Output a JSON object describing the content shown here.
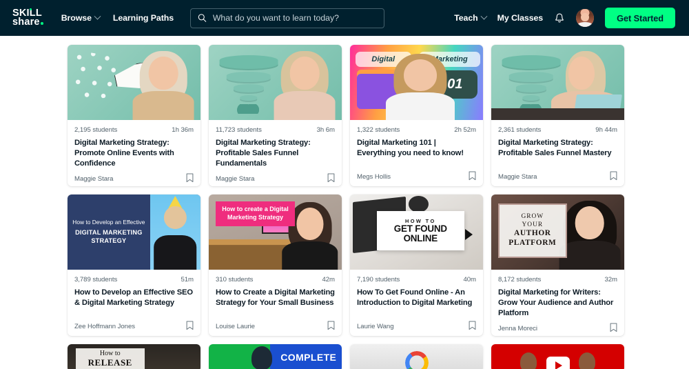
{
  "header": {
    "logo": {
      "line1": "SKILL",
      "line2": "share",
      "dot": "."
    },
    "nav": [
      {
        "label": "Browse",
        "has_chevron": true
      },
      {
        "label": "Learning Paths",
        "has_chevron": false
      }
    ],
    "search": {
      "placeholder": "What do you want to learn today?",
      "value": "",
      "icon": "search-icon"
    },
    "nav_right": [
      {
        "label": "Teach",
        "has_chevron": true
      },
      {
        "label": "My Classes",
        "has_chevron": false
      }
    ],
    "bell_icon": "bell-icon",
    "avatar": "user-avatar",
    "cta": {
      "label": "Get Started",
      "color": "#00FF84"
    }
  },
  "colors": {
    "header_bg": "#00202E",
    "accent_green": "#00FF84",
    "text_dark": "#002333",
    "meta_gray": "#52616B",
    "page_bg": "#FFFFFF"
  },
  "cards": [
    {
      "students": "2,195 students",
      "duration": "1h 36m",
      "title": "Digital Marketing Strategy: Promote Online Events with Confidence",
      "author": "Maggie Stara",
      "thumb": "megaphone-marketing-mint",
      "bookmark_icon": "bookmark-icon"
    },
    {
      "students": "11,723 students",
      "duration": "3h 6m",
      "title": "Digital Marketing Strategy: Profitable Sales Funnel Fundamentals",
      "author": "Maggie Stara",
      "thumb": "sales-funnel-mint",
      "bookmark_icon": "bookmark-icon"
    },
    {
      "students": "1,322 students",
      "duration": "2h 52m",
      "title": "Digital Marketing 101 | Everything you need to know!",
      "author": "Megs Hollis",
      "thumb": "digital-marketing-101-gradient",
      "thumb_text": {
        "left": "Digital",
        "right": "Marketing",
        "badge": "101"
      },
      "bookmark_icon": "bookmark-icon"
    },
    {
      "students": "2,361 students",
      "duration": "9h 44m",
      "title": "Digital Marketing Strategy: Profitable Sales Funnel Mastery",
      "author": "Maggie Stara",
      "thumb": "sales-funnel-laptop-mint",
      "bookmark_icon": "bookmark-icon"
    },
    {
      "students": "3,789 students",
      "duration": "51m",
      "title": "How to Develop an Effective SEO & Digital Marketing Strategy",
      "author": "Zee Hoffmann Jones",
      "thumb": "navy-seo-title-card",
      "thumb_text": {
        "line1": "How to Develop an Effective",
        "line2": "DIGITAL MARKETING STRATEGY"
      },
      "bookmark_icon": "bookmark-icon"
    },
    {
      "students": "310 students",
      "duration": "42m",
      "title": "How to Create a Digital Marketing Strategy for Your Small Business",
      "author": "Louise Laurie",
      "thumb": "pink-banner-desk",
      "thumb_text": {
        "banner": "How to create a Digital Marketing Strategy"
      },
      "bookmark_icon": "bookmark-icon"
    },
    {
      "students": "7,190 students",
      "duration": "40m",
      "title": "How To Get Found Online - An Introduction to Digital Marketing",
      "author": "Laurie Wang",
      "thumb": "get-found-online-desk",
      "thumb_text": {
        "small": "HOW TO",
        "big": "GET FOUND ONLINE"
      },
      "bookmark_icon": "bookmark-icon"
    },
    {
      "students": "8,172 students",
      "duration": "32m",
      "title": "Digital Marketing for Writers: Grow Your Audience and Author Platform",
      "author": "Jenna Moreci",
      "thumb": "grow-your-author-platform",
      "thumb_text": {
        "l1": "GROW",
        "l2": "YOUR",
        "l3": "AUTHOR",
        "l4": "PLATFORM"
      },
      "bookmark_icon": "bookmark-icon"
    }
  ],
  "partial_row": [
    {
      "thumb": "how-to-release-dark",
      "text": {
        "small": "How to",
        "big": "RELEASE"
      }
    },
    {
      "thumb": "complete-green-blue",
      "text": {
        "big": "COMPLETE"
      }
    },
    {
      "thumb": "google-logo-gray",
      "text": {
        "big": ""
      }
    },
    {
      "thumb": "youtube-red",
      "text": {
        "big": ""
      }
    }
  ]
}
